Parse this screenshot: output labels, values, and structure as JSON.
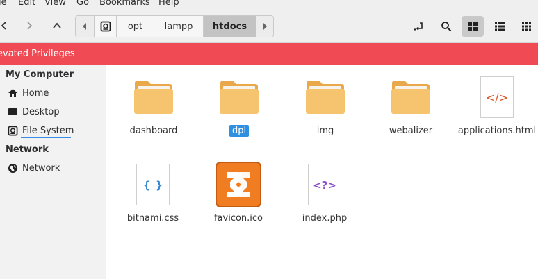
{
  "menu": [
    "le",
    "Edit",
    "View",
    "Go",
    "Bookmarks",
    "Help"
  ],
  "breadcrumbs": [
    "opt",
    "lampp",
    "htdocs"
  ],
  "banner": "evated Privileges",
  "sidebar": {
    "sections": [
      {
        "title": "My Computer",
        "items": [
          "Home",
          "Desktop",
          "File System"
        ]
      },
      {
        "title": "Network",
        "items": [
          "Network"
        ]
      }
    ]
  },
  "files": [
    {
      "name": "dashboard",
      "icon": "folder-icon"
    },
    {
      "name": "dpl",
      "icon": "folder-icon",
      "selected": true
    },
    {
      "name": "img",
      "icon": "folder-icon"
    },
    {
      "name": "webalizer",
      "icon": "folder-icon"
    },
    {
      "name": "applications.html",
      "icon": "html-file-icon",
      "glyph": "</>"
    },
    {
      "name": "bitnami.css",
      "icon": "css-file-icon",
      "glyph": "{ }"
    },
    {
      "name": "favicon.ico",
      "icon": "xampp-icon"
    },
    {
      "name": "index.php",
      "icon": "php-file-icon",
      "glyph": "<?>"
    }
  ],
  "colors": {
    "banner": "#f04a54",
    "selection": "#2f8fe0",
    "folder": "#f6c46e",
    "html_glyph": "#e0562a",
    "css_glyph": "#2f86d6",
    "php_glyph": "#8d4fc9",
    "xampp": "#f07d22"
  }
}
